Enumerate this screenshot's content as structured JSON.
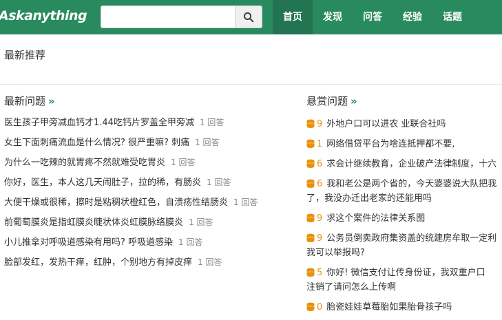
{
  "header": {
    "logo": "Askanything",
    "search": {
      "value": "",
      "placeholder": ""
    },
    "nav": [
      {
        "label": "首页",
        "active": true
      },
      {
        "label": "发现",
        "active": false
      },
      {
        "label": "问答",
        "active": false
      },
      {
        "label": "经验",
        "active": false
      },
      {
        "label": "话题",
        "active": false
      }
    ]
  },
  "section": {
    "title": "最新推荐"
  },
  "latest": {
    "title": "最新问题",
    "more": "»",
    "items": [
      {
        "text": "医生孩子甲旁减血钙才1.44吃钙片罗盖全甲旁减",
        "count": "1 回答"
      },
      {
        "text": "女生下面刺痛流血是什么情况? 很严重嘛? 刺痛",
        "count": "1 回答"
      },
      {
        "text": "为什么一吃辣的就胃疼不然就难受吃胃炎",
        "count": "1 回答"
      },
      {
        "text": "你好，医生，本人这几天闹肚子，拉的稀，有肠炎",
        "count": "1 回答"
      },
      {
        "text": "大便干燥或很稀，擦时是粘稠状橙红色，自溃疡性结肠炎",
        "count": "1 回答"
      },
      {
        "text": "前葡萄膜炎是指虹膜炎睫状体炎虹膜脉络膜炎",
        "count": "1 回答"
      },
      {
        "text": "小儿推拿对呼吸道感染有用吗? 呼吸道感染",
        "count": "1 回答"
      },
      {
        "text": "脸部发红，发热干痒，红肿，个别地方有掉皮痒",
        "count": "1 回答"
      }
    ]
  },
  "reward": {
    "title": "悬赏问题",
    "more": "»",
    "items": [
      {
        "num": "9",
        "line1": "外地户口可以进农 业联合社吗",
        "line2": ""
      },
      {
        "num": "1",
        "line1": "网络借贷平台为啥连抵押都不要,",
        "line2": ""
      },
      {
        "num": "6",
        "line1": "求会计继续教育，企业破产法律制度，十六",
        "line2": ""
      },
      {
        "num": "6",
        "line1": "我和老公是两个省的，今天婆婆说大队把我",
        "line2": "了，我没办迁出老家的还能用吗"
      },
      {
        "num": "9",
        "line1": "求这个案件的法律关系图",
        "line2": ""
      },
      {
        "num": "9",
        "line1": "公务员倒卖政府集资盖的统建房牟取一定利",
        "line2": "我可以举报吗?"
      },
      {
        "num": "5",
        "line1": "你好! 微信支付让传身份证，我双重户口",
        "line2": "注销了请问怎么上传啊"
      },
      {
        "num": "0",
        "line1": "胎瓷娃娃草莓胎如果胎骨孩子吗",
        "line2": ""
      }
    ]
  },
  "colors": {
    "brand": "#2a8a5f",
    "brand_dark": "#237451",
    "coin": "#e8920b"
  }
}
